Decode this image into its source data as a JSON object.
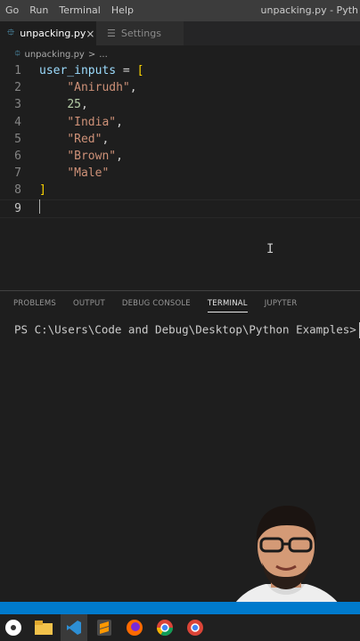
{
  "menu": {
    "items": [
      "Go",
      "Run",
      "Terminal",
      "Help"
    ],
    "window_title": "unpacking.py - Pyth"
  },
  "tabs": [
    {
      "label": "unpacking.py",
      "close": "×"
    },
    {
      "label": "Settings"
    }
  ],
  "breadcrumb": {
    "file": "unpacking.py",
    "separator": ">",
    "more": "..."
  },
  "editor": {
    "lines": [
      {
        "num": "1",
        "parts": [
          [
            "var",
            "user_inputs"
          ],
          [
            "op",
            " = "
          ],
          [
            "bracket",
            "["
          ]
        ]
      },
      {
        "num": "2",
        "parts": [
          [
            "op",
            "    "
          ],
          [
            "str",
            "\"Anirudh\""
          ],
          [
            "op",
            ","
          ]
        ]
      },
      {
        "num": "3",
        "parts": [
          [
            "op",
            "    "
          ],
          [
            "numlit",
            "25"
          ],
          [
            "op",
            ","
          ]
        ]
      },
      {
        "num": "4",
        "parts": [
          [
            "op",
            "    "
          ],
          [
            "str",
            "\"India\""
          ],
          [
            "op",
            ","
          ]
        ]
      },
      {
        "num": "5",
        "parts": [
          [
            "op",
            "    "
          ],
          [
            "str",
            "\"Red\""
          ],
          [
            "op",
            ","
          ]
        ]
      },
      {
        "num": "6",
        "parts": [
          [
            "op",
            "    "
          ],
          [
            "str",
            "\"Brown\""
          ],
          [
            "op",
            ","
          ]
        ]
      },
      {
        "num": "7",
        "parts": [
          [
            "op",
            "    "
          ],
          [
            "str",
            "\"Male\""
          ]
        ]
      },
      {
        "num": "8",
        "parts": [
          [
            "bracket",
            "]"
          ]
        ]
      },
      {
        "num": "9",
        "parts": []
      }
    ]
  },
  "panel": {
    "tabs": [
      "PROBLEMS",
      "OUTPUT",
      "DEBUG CONSOLE",
      "TERMINAL",
      "JUPYTER"
    ],
    "active_tab": "TERMINAL",
    "terminal_prompt": "PS C:\\Users\\Code and Debug\\Desktop\\Python Examples>"
  },
  "taskbar": {
    "icons": [
      "soccer-app-icon",
      "file-explorer-icon",
      "vscode-icon",
      "sublime-text-icon",
      "firefox-icon",
      "chrome-icon",
      "chrome-icon-2"
    ]
  },
  "colors": {
    "editor_bg": "#1e1e1e",
    "variable": "#9cdcfe",
    "string": "#ce9178",
    "number": "#b5cea8",
    "bracket": "#ffd700",
    "status_bar": "#007acc"
  }
}
